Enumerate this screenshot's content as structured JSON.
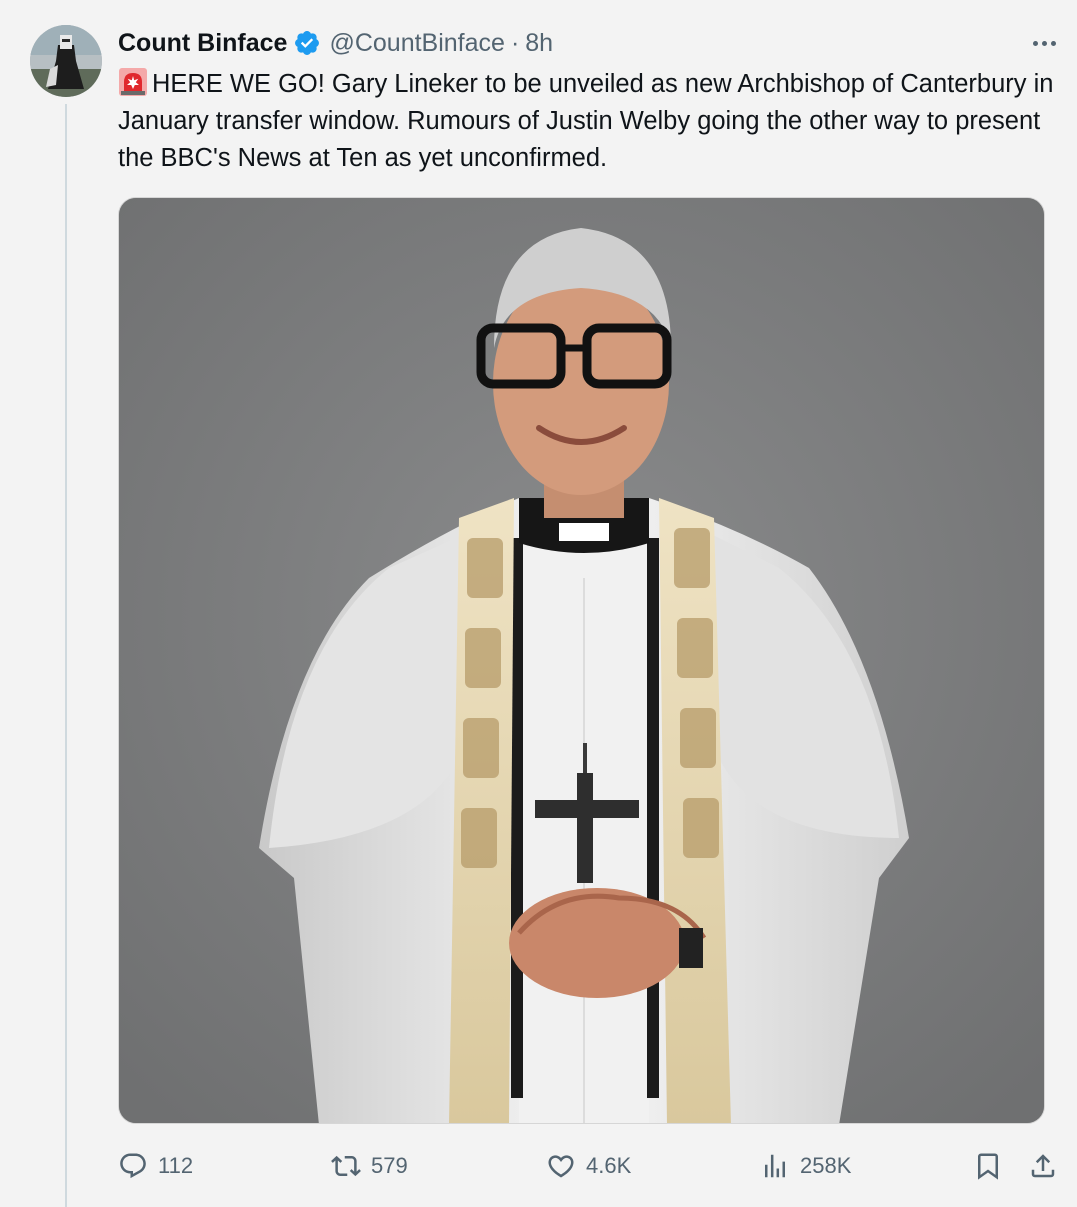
{
  "author": {
    "display_name": "Count Binface",
    "handle": "@CountBinface",
    "separator": "·",
    "time": "8h"
  },
  "tweet": {
    "emoji": "siren-emoji",
    "text": "HERE WE GO! Gary Lineker to be unveiled as new Archbishop of Canterbury in January transfer window. Rumours of Justin Welby going the other way to present the BBC's News at Ten as yet unconfirmed."
  },
  "metrics": {
    "replies": "112",
    "retweets": "579",
    "likes": "4.6K",
    "views": "258K"
  },
  "colors": {
    "verified": "#1d9bf0",
    "secondary_text": "#536471",
    "background": "#f3f3f3",
    "media_background": "#7d7e7f"
  },
  "icons": [
    "verified-badge-icon",
    "more-icon",
    "siren-icon",
    "reply-icon",
    "retweet-icon",
    "like-icon",
    "views-icon",
    "bookmark-icon",
    "share-icon"
  ]
}
